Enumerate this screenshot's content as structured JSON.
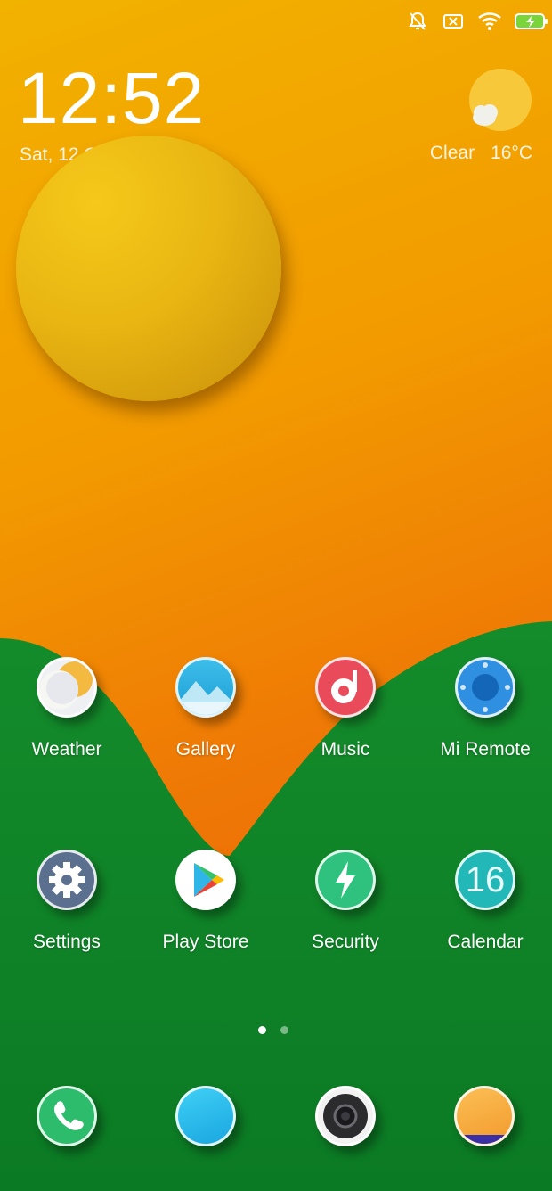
{
  "status_bar": {
    "icons": [
      "silent-bell-icon",
      "sim-error-icon",
      "wifi-icon",
      "battery-charging-icon"
    ]
  },
  "clock": {
    "time": "12:52",
    "date": "Sat, 12 October"
  },
  "weather": {
    "icon": "partly-sunny-icon",
    "condition": "Clear",
    "temperature": "16°C"
  },
  "apps_row1": [
    {
      "label": "Weather",
      "icon": "weather-icon"
    },
    {
      "label": "Gallery",
      "icon": "gallery-icon"
    },
    {
      "label": "Music",
      "icon": "music-icon"
    },
    {
      "label": "Mi Remote",
      "icon": "remote-icon"
    }
  ],
  "apps_row2": [
    {
      "label": "Settings",
      "icon": "gear-icon"
    },
    {
      "label": "Play Store",
      "icon": "play-store-icon"
    },
    {
      "label": "Security",
      "icon": "security-bolt-icon"
    },
    {
      "label": "Calendar",
      "icon": "calendar-icon",
      "day": "16"
    }
  ],
  "page_indicator": {
    "pages": 2,
    "current": 1
  },
  "dock": [
    {
      "icon": "phone-icon"
    },
    {
      "icon": "messages-icon"
    },
    {
      "icon": "camera-icon"
    },
    {
      "icon": "browser-icon"
    }
  ],
  "colors": {
    "wallpaper_orange": "#ef7a05",
    "wallpaper_green": "#0f8a2a",
    "sun_yellow": "#e9b612"
  }
}
